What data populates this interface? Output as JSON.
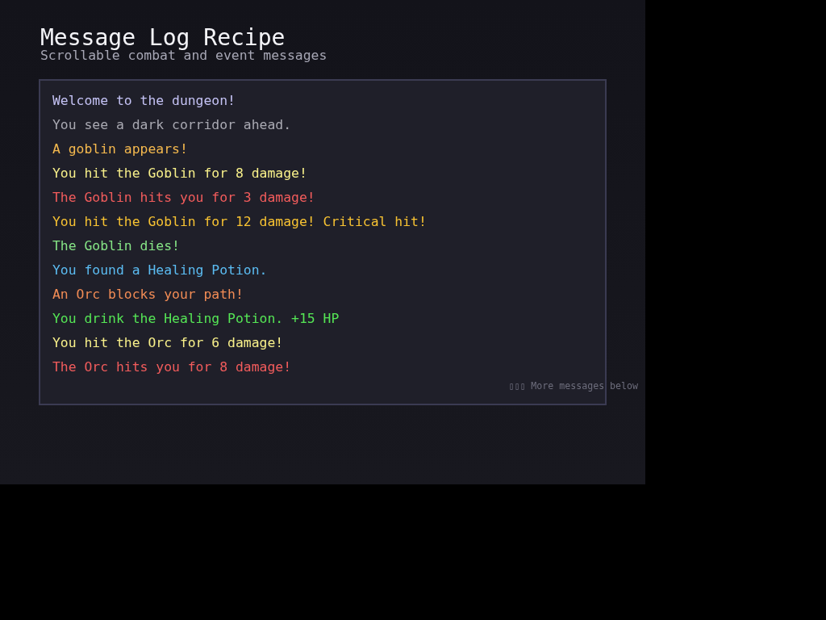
{
  "header": {
    "title": "Message Log Recipe",
    "subtitle": "Scrollable combat and event messages"
  },
  "log": {
    "messages": [
      {
        "text": "Welcome to the dungeon!",
        "color": "#c4c2f4"
      },
      {
        "text": "You see a dark corridor ahead.",
        "color": "#a9a9b2"
      },
      {
        "text": "A goblin appears!",
        "color": "#f5b94e"
      },
      {
        "text": "You hit the Goblin for 8 damage!",
        "color": "#f8f08a"
      },
      {
        "text": "The Goblin hits you for 3 damage!",
        "color": "#f25c5c"
      },
      {
        "text": "You hit the Goblin for 12 damage! Critical hit!",
        "color": "#f7c232"
      },
      {
        "text": "The Goblin dies!",
        "color": "#86e586"
      },
      {
        "text": "You found a Healing Potion.",
        "color": "#5bbcf2"
      },
      {
        "text": "An Orc blocks your path!",
        "color": "#f28c55"
      },
      {
        "text": "You drink the Healing Potion. +15 HP",
        "color": "#55e655"
      },
      {
        "text": "You hit the Orc for 6 damage!",
        "color": "#f8f08a"
      },
      {
        "text": "The Orc hits you for 8 damage!",
        "color": "#f25c5c"
      }
    ],
    "more_indicator": "▯▯▯ More messages below"
  }
}
